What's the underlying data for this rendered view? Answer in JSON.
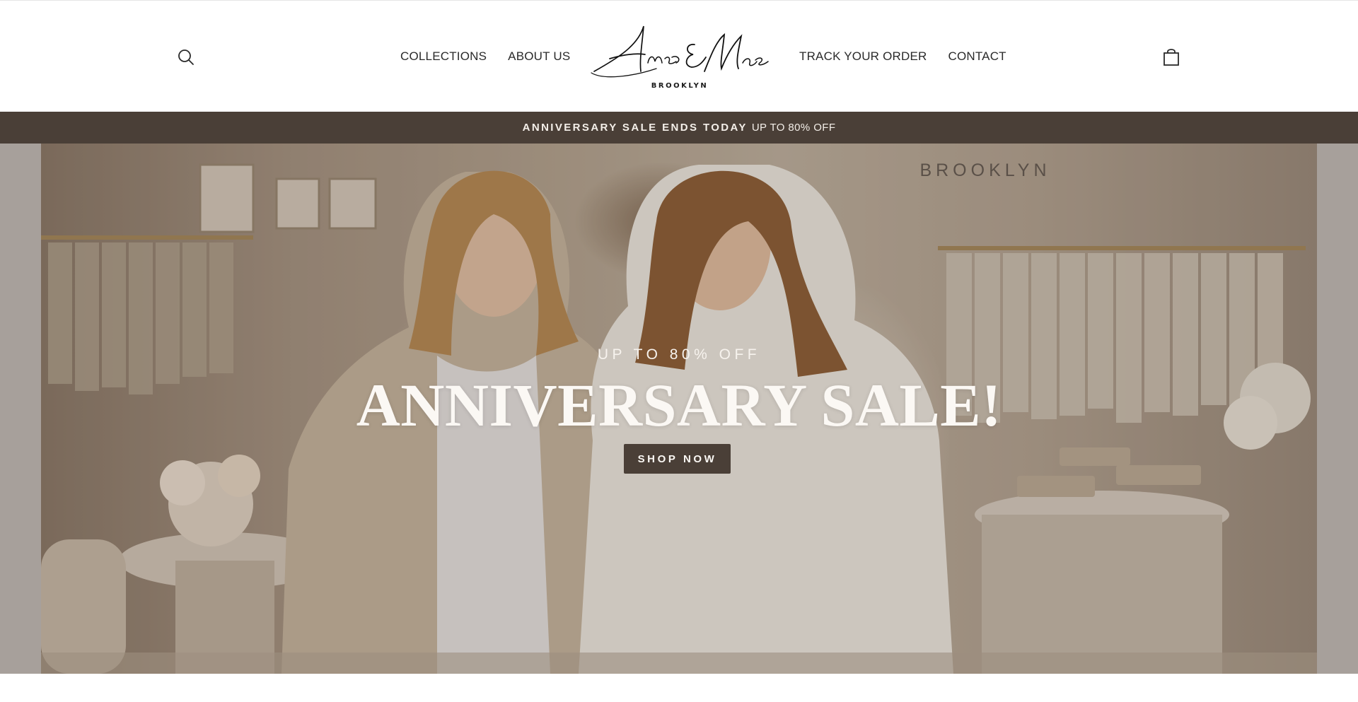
{
  "header": {
    "nav_left": [
      {
        "label": "COLLECTIONS"
      },
      {
        "label": "ABOUT US"
      }
    ],
    "nav_right": [
      {
        "label": "TRACK YOUR ORDER"
      },
      {
        "label": "CONTACT"
      }
    ],
    "logo": {
      "script_text": "Anne & Mae",
      "subtitle": "BROOKLYN"
    },
    "icons": {
      "search": "search-icon",
      "cart": "shopping-bag-icon"
    }
  },
  "announcement": {
    "bold_text": "ANNIVERSARY SALE ENDS TODAY",
    "light_text": "UP TO 80% OFF",
    "background": "#4a3f37"
  },
  "hero": {
    "store_sign": "BROOKLYN",
    "eyebrow": "UP TO 80% OFF",
    "title": "ANNIVERSARY SALE!",
    "cta_label": "SHOP NOW",
    "cta_color": "#4a3f37"
  }
}
